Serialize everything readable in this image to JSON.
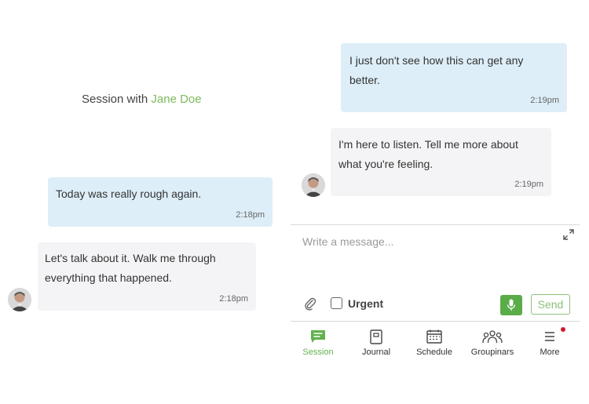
{
  "session": {
    "title_prefix": "Session with",
    "client_name": "Jane Doe"
  },
  "left_messages": [
    {
      "type": "sent",
      "text": "Today was really rough again.",
      "time": "2:18pm"
    },
    {
      "type": "received",
      "lines": [
        "Let's talk about it. Walk me through",
        "everything that happened."
      ],
      "time": "2:18pm"
    }
  ],
  "right_messages": [
    {
      "type": "sent",
      "lines": [
        "I just don't see how this can get any",
        "better."
      ],
      "time": "2:19pm"
    },
    {
      "type": "received",
      "lines": [
        "I'm here to listen. Tell me more about",
        "what you're feeling."
      ],
      "time": "2:19pm"
    }
  ],
  "composer": {
    "placeholder": "Write a message...",
    "urgent_label": "Urgent",
    "send_label": "Send"
  },
  "nav": [
    {
      "label": "Session",
      "icon": "chat-icon",
      "active": true
    },
    {
      "label": "Journal",
      "icon": "journal-icon",
      "active": false
    },
    {
      "label": "Schedule",
      "icon": "calendar-icon",
      "active": false
    },
    {
      "label": "Groupinars",
      "icon": "group-icon",
      "active": false
    },
    {
      "label": "More",
      "icon": "menu-icon",
      "active": false,
      "notification": true
    }
  ],
  "colors": {
    "accent_green": "#62b14e",
    "sent_bubble": "#ddeef8",
    "received_bubble": "#f4f4f6",
    "notification_dot": "#d01c2c"
  }
}
